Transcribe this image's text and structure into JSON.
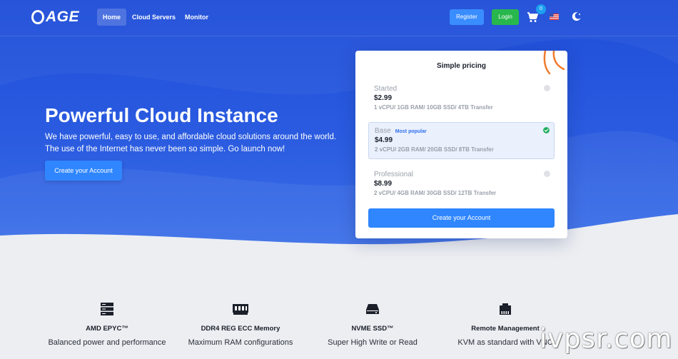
{
  "brand": {
    "logo_text": "AGE"
  },
  "nav": {
    "links": [
      "Home",
      "Cloud Servers",
      "Monitor"
    ],
    "register_label": "Register",
    "login_label": "Login",
    "cart_count": "0"
  },
  "hero": {
    "title": "Powerful Cloud Instance",
    "subtitle": "We have powerful, easy to use, and affordable cloud solutions around the world. The use of the Internet has never been so simple. Go launch now!",
    "cta_label": "Create your Account"
  },
  "pricing": {
    "title": "Simple pricing",
    "plans": [
      {
        "name": "Started",
        "price": "$2.99",
        "specs": "1 vCPU/ 1GB RAM/ 10GB SSD/ 4TB Transfer",
        "tag": "",
        "selected": false
      },
      {
        "name": "Base",
        "price": "$4.99",
        "specs": "2 vCPU/ 2GB RAM/ 20GB SSD/ 8TB Transfer",
        "tag": "Most popular",
        "selected": true
      },
      {
        "name": "Professional",
        "price": "$8.99",
        "specs": "2 vCPU/ 4GB RAM/ 30GB SSD/ 12TB Transfer",
        "tag": "",
        "selected": false
      }
    ],
    "cta_label": "Create your Account"
  },
  "features": [
    {
      "icon": "server-icon",
      "title": "AMD EPYC™",
      "desc": "Balanced power and performance"
    },
    {
      "icon": "memory-icon",
      "title": "DDR4 REG ECC Memory",
      "desc": "Maximum RAM configurations"
    },
    {
      "icon": "ssd-icon",
      "title": "NVME SSD™",
      "desc": "Super High Write or Read"
    },
    {
      "icon": "network-icon",
      "title": "Remote Management",
      "desc": "KVM as standard with VNC"
    }
  ],
  "watermark": "ivpsr.com",
  "colors": {
    "hero": "#1f4ed8",
    "button": "#2f86ff",
    "login": "#28b74c",
    "check": "#1fae5b"
  }
}
